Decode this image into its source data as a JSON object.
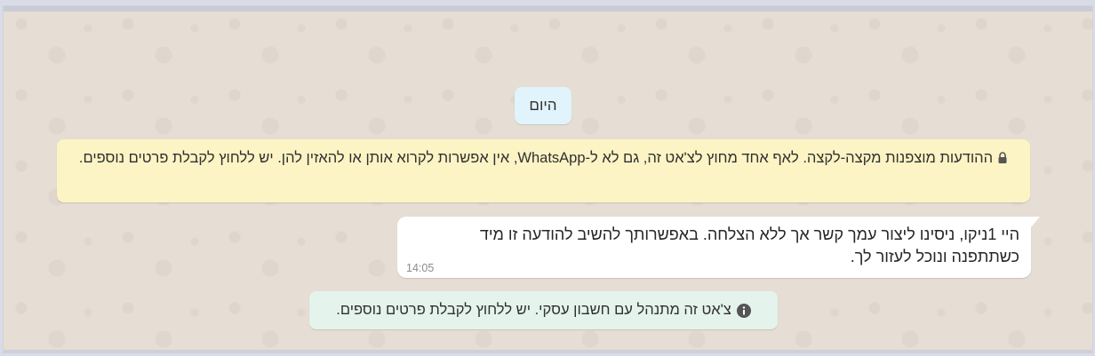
{
  "chat": {
    "date_chip": "היום",
    "encryption_notice": "ההודעות מוצפנות מקצה-לקצה. לאף אחד מחוץ לצ'אט זה, גם לא ל-WhatsApp, אין אפשרות לקרוא אותן או להאזין להן. יש ללחוץ לקבלת פרטים נוספים.",
    "message": {
      "text": "היי 1ניקו, ניסינו ליצור עמך קשר אך ללא הצלחה. באפשרותך להשיב להודעה זו מיד כשתתפנה ונוכל לעזור לך.",
      "time": "14:05"
    },
    "business_notice": "צ'אט זה מתנהל עם חשבון עסקי. יש ללחוץ לקבלת פרטים נוספים."
  },
  "icons": {
    "lock": "lock-icon",
    "info": "info-icon"
  },
  "colors": {
    "chat_background": "#e6ddd4",
    "encryption_bg": "#fcf4c4",
    "business_bg": "#e4f3ec",
    "date_chip_bg": "#e1f3fb",
    "message_bg": "#ffffff"
  }
}
